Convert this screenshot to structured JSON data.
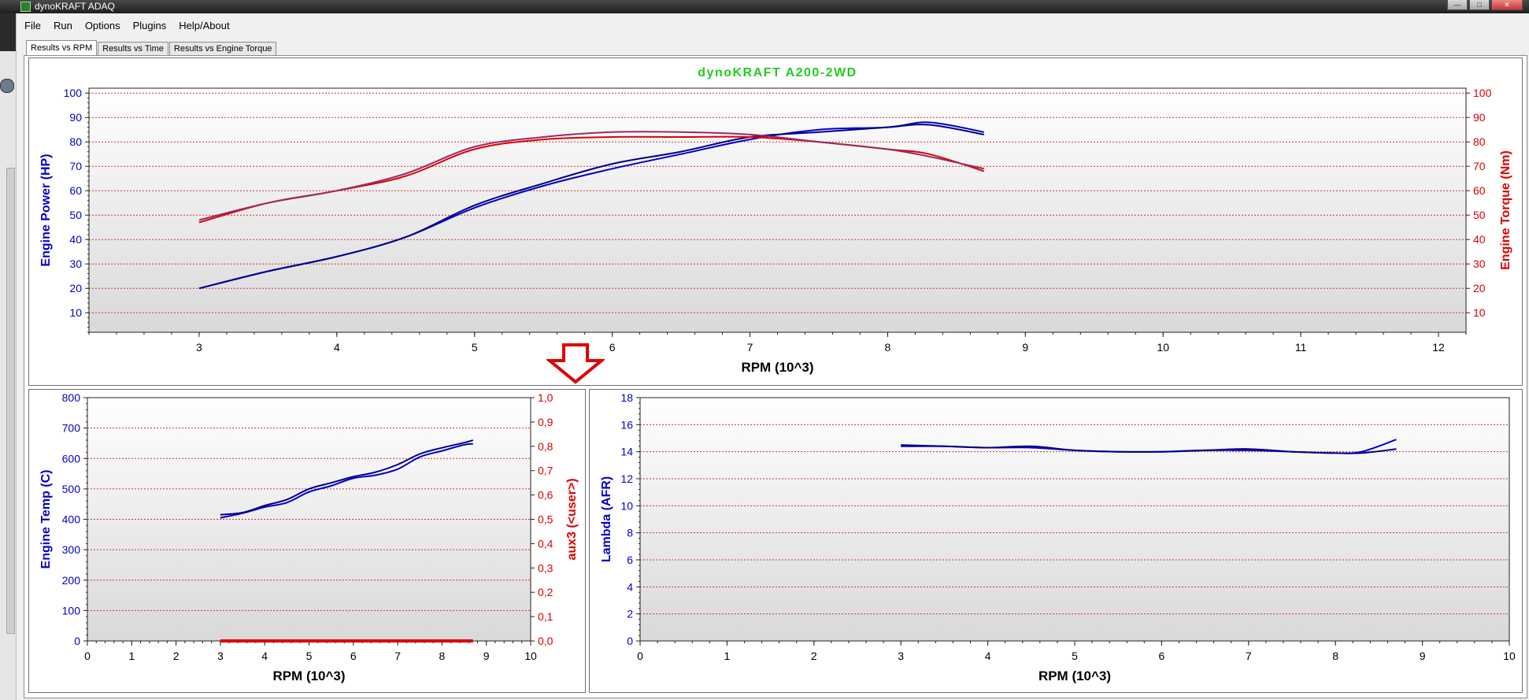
{
  "window": {
    "title": "dynoKRAFT ADAQ",
    "icon": "app-logo-icon"
  },
  "menu": [
    "File",
    "Run",
    "Options",
    "Plugins",
    "Help/About"
  ],
  "tabs": [
    "Results vs RPM",
    "Results vs Time",
    "Results vs Engine Torque"
  ],
  "active_tab": 0,
  "colors": {
    "blue": "#0000cc",
    "red": "#dd0000",
    "title_green": "#22cc22",
    "grid": "#cc3333"
  },
  "chart_data": [
    {
      "type": "line",
      "title": "dynoKRAFT A200-2WD",
      "xlabel": "RPM (10^3)",
      "ylabel": "Engine Power (HP)",
      "y2label": "Engine Torque (Nm)",
      "xlim": [
        2.2,
        12.2
      ],
      "ylim": [
        2,
        102
      ],
      "y2lim": [
        2,
        102
      ],
      "xticks": [
        3,
        4,
        5,
        6,
        7,
        8,
        9,
        10,
        11,
        12
      ],
      "yticks": [
        10,
        20,
        30,
        40,
        50,
        60,
        70,
        80,
        90,
        100
      ],
      "y2ticks": [
        10,
        20,
        30,
        40,
        50,
        60,
        70,
        80,
        90,
        100
      ],
      "grid": true,
      "series": [
        {
          "axis": "left",
          "color": "#0000cc",
          "x": [
            3.0,
            3.5,
            4.0,
            4.5,
            5.0,
            5.5,
            6.0,
            6.5,
            7.0,
            7.5,
            8.0,
            8.3,
            8.7
          ],
          "y": [
            20,
            27,
            33,
            41,
            53,
            62,
            69,
            75,
            81,
            85,
            86,
            88,
            84
          ]
        },
        {
          "axis": "left",
          "color": "#000088",
          "x": [
            3.0,
            3.5,
            4.0,
            4.5,
            5.0,
            5.5,
            6.0,
            6.5,
            7.0,
            7.5,
            8.0,
            8.3,
            8.7
          ],
          "y": [
            20,
            27,
            33,
            41,
            54,
            63,
            71,
            76,
            82,
            84,
            86,
            87,
            83
          ]
        },
        {
          "axis": "right",
          "color": "#dd0000",
          "x": [
            3.0,
            3.5,
            4.0,
            4.5,
            5.0,
            5.5,
            6.0,
            6.5,
            7.0,
            7.5,
            8.0,
            8.3,
            8.7
          ],
          "y": [
            47,
            55,
            60,
            66,
            77,
            81,
            82,
            82,
            82,
            80,
            77,
            75,
            68
          ]
        },
        {
          "axis": "right",
          "color": "#9a2a66",
          "x": [
            3.0,
            3.5,
            4.0,
            4.5,
            5.0,
            5.5,
            6.0,
            6.5,
            7.0,
            7.5,
            8.0,
            8.3,
            8.7
          ],
          "y": [
            48,
            55,
            60,
            67,
            78,
            82,
            84,
            84,
            83,
            80,
            77,
            74,
            69
          ]
        }
      ]
    },
    {
      "type": "line",
      "xlabel": "RPM (10^3)",
      "ylabel": "Engine Temp (C)",
      "y2label": "aux3 (<user>)",
      "xlim": [
        0,
        10
      ],
      "ylim": [
        0,
        800
      ],
      "y2lim": [
        0,
        1
      ],
      "xticks": [
        0,
        1,
        2,
        3,
        4,
        5,
        6,
        7,
        8,
        9,
        10
      ],
      "yticks": [
        0,
        100,
        200,
        300,
        400,
        500,
        600,
        700,
        800
      ],
      "y2ticks": [
        "0,0",
        "0,1",
        "0,2",
        "0,3",
        "0,4",
        "0,5",
        "0,6",
        "0,7",
        "0,8",
        "0,9",
        "1,0"
      ],
      "grid": true,
      "series": [
        {
          "axis": "left",
          "color": "#0000cc",
          "x": [
            3.0,
            3.5,
            4.0,
            4.5,
            5.0,
            5.5,
            6.0,
            6.5,
            7.0,
            7.5,
            8.0,
            8.5,
            8.7
          ],
          "y": [
            405,
            420,
            440,
            455,
            490,
            510,
            535,
            545,
            565,
            605,
            625,
            645,
            648
          ]
        },
        {
          "axis": "left",
          "color": "#000088",
          "x": [
            3.0,
            3.5,
            4.0,
            4.5,
            5.0,
            5.5,
            6.0,
            6.5,
            7.0,
            7.5,
            8.0,
            8.5,
            8.7
          ],
          "y": [
            415,
            422,
            445,
            465,
            500,
            520,
            540,
            555,
            580,
            615,
            635,
            652,
            660
          ]
        },
        {
          "axis": "right",
          "color": "#dd0000",
          "x": [
            3.0,
            8.7
          ],
          "y": [
            0.0,
            0.0
          ]
        }
      ]
    },
    {
      "type": "line",
      "xlabel": "RPM (10^3)",
      "ylabel": "Lambda (AFR)",
      "xlim": [
        0,
        10
      ],
      "ylim": [
        0,
        18
      ],
      "xticks": [
        0,
        1,
        2,
        3,
        4,
        5,
        6,
        7,
        8,
        9,
        10
      ],
      "yticks": [
        0,
        2,
        4,
        6,
        8,
        10,
        12,
        14,
        16,
        18
      ],
      "grid": true,
      "series": [
        {
          "axis": "left",
          "color": "#0000cc",
          "x": [
            3.0,
            3.5,
            4.0,
            4.5,
            5.0,
            5.5,
            6.0,
            6.5,
            7.0,
            7.5,
            8.0,
            8.3,
            8.7
          ],
          "y": [
            14.5,
            14.4,
            14.3,
            14.3,
            14.1,
            14.0,
            14.0,
            14.1,
            14.1,
            14.0,
            13.9,
            14.0,
            14.9
          ]
        },
        {
          "axis": "left",
          "color": "#000088",
          "x": [
            3.0,
            3.5,
            4.0,
            4.5,
            5.0,
            5.5,
            6.0,
            6.5,
            7.0,
            7.5,
            8.0,
            8.3,
            8.7
          ],
          "y": [
            14.4,
            14.4,
            14.3,
            14.4,
            14.1,
            14.0,
            14.0,
            14.1,
            14.2,
            14.0,
            13.9,
            13.9,
            14.2
          ]
        }
      ]
    }
  ]
}
